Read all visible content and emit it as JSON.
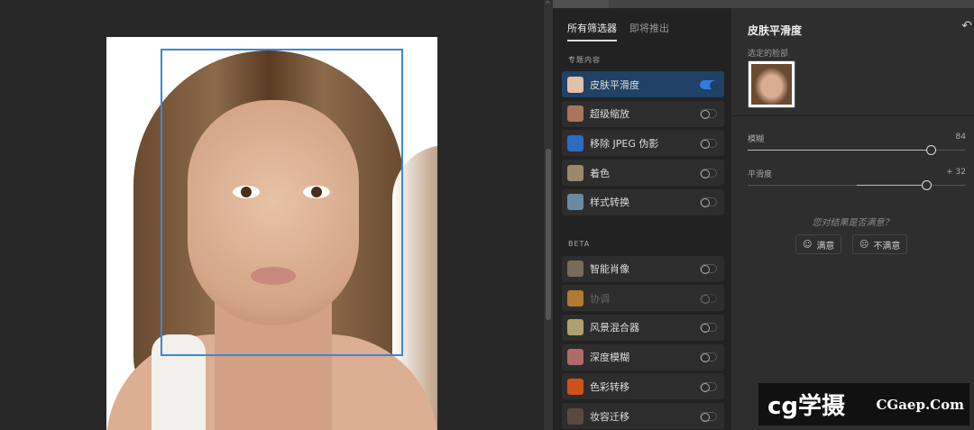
{
  "filters_panel": {
    "tabs": [
      {
        "label": "所有筛选器",
        "active": true
      },
      {
        "label": "即将推出",
        "active": false
      }
    ],
    "sections": [
      {
        "title": "专题内容",
        "items": [
          {
            "label": "皮肤平滑度",
            "on": true,
            "active": true,
            "thumb": "#e3c0a8"
          },
          {
            "label": "超级缩放",
            "on": false,
            "thumb": "#a8765a"
          },
          {
            "label": "移除 JPEG 伪影",
            "on": false,
            "thumb": "#2d6cc0"
          },
          {
            "label": "着色",
            "on": false,
            "thumb": "#9a8a6a"
          },
          {
            "label": "样式转换",
            "on": false,
            "thumb": "#6a8aa0"
          }
        ]
      },
      {
        "title": "BETA",
        "items": [
          {
            "label": "智能肖像",
            "on": false,
            "thumb": "#7a6a5a"
          },
          {
            "label": "协调",
            "on": false,
            "dim": true,
            "thumb": "#b07a30"
          },
          {
            "label": "风景混合器",
            "on": false,
            "thumb": "#b0a070"
          },
          {
            "label": "深度模糊",
            "on": false,
            "thumb": "#b06a6a"
          },
          {
            "label": "色彩转移",
            "on": false,
            "thumb": "#d0501a"
          },
          {
            "label": "妆容迁移",
            "on": false,
            "thumb": "#5a4a3a"
          }
        ]
      }
    ]
  },
  "detail": {
    "title": "皮肤平滑度",
    "reset_icon": "undo-icon",
    "face_label": "选定的脸部",
    "sliders": [
      {
        "label": "模糊",
        "value_text": "84",
        "value": 84,
        "min": 0,
        "max": 100,
        "centered": false
      },
      {
        "label": "平滑度",
        "value_text": "+ 32",
        "value": 32,
        "min": -50,
        "max": 50,
        "centered": true
      }
    ],
    "question": "您对结果是否满意？",
    "feedback": [
      {
        "label": "满意",
        "icon": "smile-icon"
      },
      {
        "label": "不满意",
        "icon": "frown-icon"
      }
    ]
  },
  "watermark": {
    "logo": "cg学摄",
    "site": "CGaep.Com"
  },
  "colors": {
    "accent": "#2f7de1",
    "face_box": "#3d86d6",
    "active_item": "#1f4266"
  }
}
